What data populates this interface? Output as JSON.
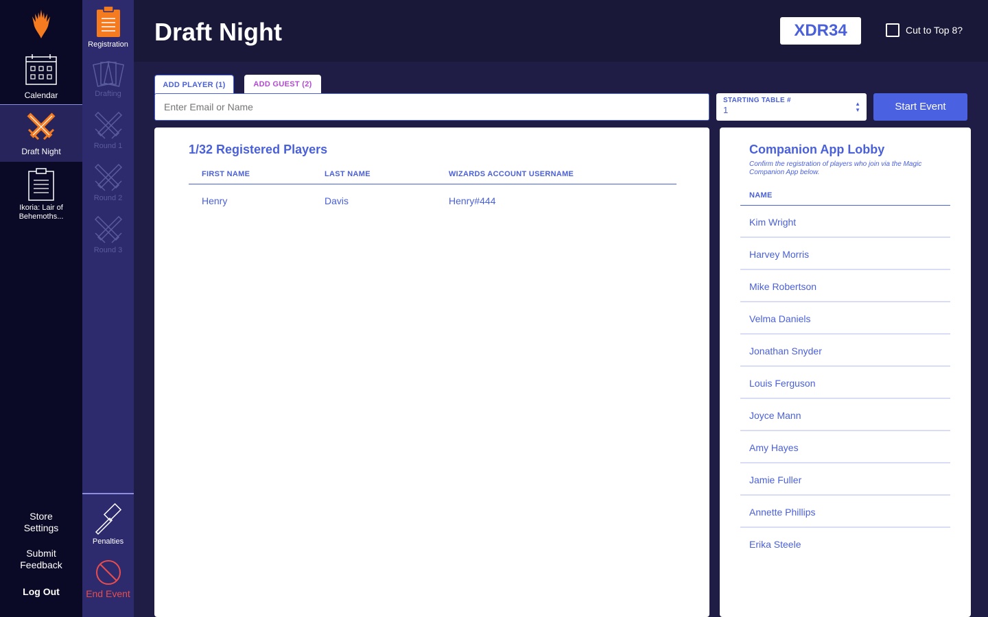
{
  "nav": {
    "items": [
      {
        "label": "Calendar",
        "icon": "calendar-icon"
      },
      {
        "label": "Draft Night",
        "icon": "crossed-swords-icon"
      },
      {
        "label": "Ikoria: Lair of Behemoths...",
        "icon": "clipboard-icon"
      }
    ],
    "store_settings": "Store Settings",
    "submit_feedback": "Submit Feedback",
    "logout": "Log Out"
  },
  "stages": {
    "registration": "Registration",
    "drafting": "Drafting",
    "round1": "Round 1",
    "round2": "Round 2",
    "round3": "Round 3",
    "penalties": "Penalties",
    "end_event": "End Event"
  },
  "header": {
    "title": "Draft Night",
    "event_code": "XDR34",
    "cut_label": "Cut to Top 8?"
  },
  "tabs": {
    "add_player": "ADD PLAYER (1)",
    "add_guest": "ADD GUEST (2)"
  },
  "search": {
    "placeholder": "Enter Email or Name"
  },
  "starting_table": {
    "label": "STARTING TABLE #",
    "value": "1"
  },
  "start_button": "Start Event",
  "players": {
    "title": "1/32 Registered Players",
    "columns": [
      "FIRST NAME",
      "LAST NAME",
      "WIZARDS ACCOUNT USERNAME"
    ],
    "rows": [
      {
        "first": "Henry",
        "last": "Davis",
        "username": "Henry#444"
      }
    ]
  },
  "lobby": {
    "title": "Companion App Lobby",
    "subtitle": "Confirm the registration of players who join via the Magic Companion App below.",
    "column": "NAME",
    "names": [
      "Kim Wright",
      "Harvey Morris",
      "Mike Robertson",
      "Velma Daniels",
      "Jonathan Snyder",
      "Louis Ferguson",
      "Joyce Mann",
      "Amy Hayes",
      "Jamie Fuller",
      "Annette Phillips",
      "Erika Steele"
    ]
  },
  "colors": {
    "accent": "#4a60d8",
    "brand_orange": "#f47b20",
    "nav_bg": "#0b0a26",
    "rail_bg": "#2d2a6e",
    "danger": "#e84e4e",
    "guest_tab": "#b04ad0"
  }
}
